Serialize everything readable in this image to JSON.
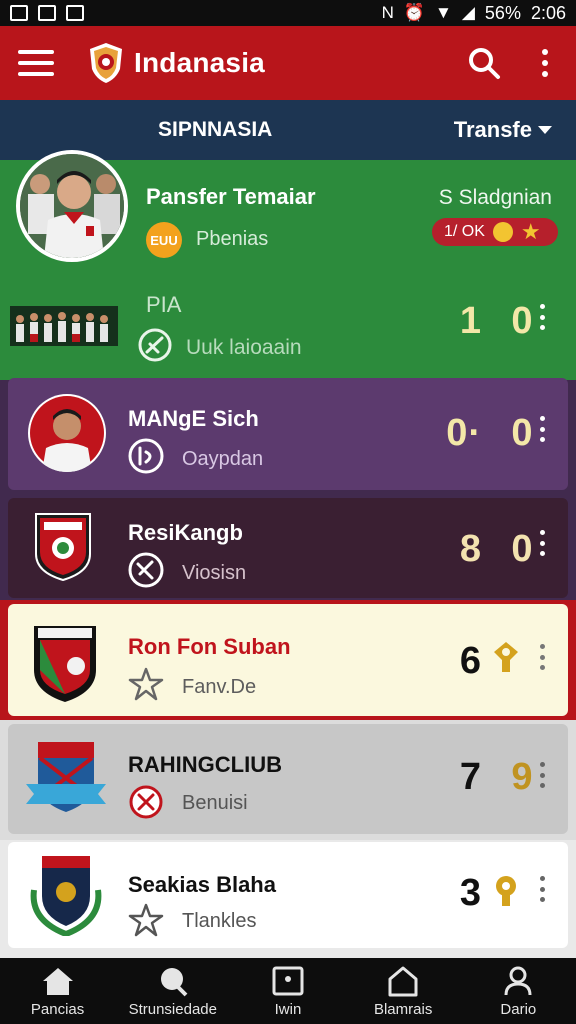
{
  "status_bar": {
    "left_icons": [
      "notification-icon",
      "image-icon",
      "image-icon"
    ],
    "right_icons": [
      "nfc-icon",
      "alarm-icon",
      "wifi-icon",
      "signal-icon"
    ],
    "battery": "56%",
    "time": "2:06"
  },
  "app_bar": {
    "title": "Indanasia",
    "menu_icon": "menu-icon",
    "search_icon": "search-icon",
    "more_icon": "more-vertical-icon"
  },
  "sub_header": {
    "title": "SIPNNASIA",
    "dropdown_label": "Transfe"
  },
  "hero": {
    "name": "Pansfer Temaiar",
    "badge": "EUU",
    "subtitle": "Pbenias",
    "right_text": "S Sladgnian",
    "pill_text": "1/  OK"
  },
  "row2": {
    "title": "PIA",
    "subtitle": "Uuk laioaain",
    "score_home": "1",
    "score_away": "0"
  },
  "cards": [
    {
      "title": "MANgE Sich",
      "subtitle": "Oaypdan",
      "score_home": "0·",
      "score_away": "0",
      "icon": "whistle-icon",
      "colors": {
        "bg": "#5c3a6e",
        "title": "#ffffff",
        "sub": "#d9c8e4",
        "score": "#f3e7a8"
      }
    },
    {
      "title": "ResiKangb",
      "subtitle": "Viosisn",
      "score_home": "8",
      "score_away": "0",
      "icon": "tactics-icon",
      "colors": {
        "bg": "#3a1f32",
        "title": "#ffffff",
        "sub": "#d6c2cc",
        "score": "#f3e2b0"
      }
    },
    {
      "title": "Ron Fon Suban",
      "subtitle": "Fanv.De",
      "score_home": "6",
      "score_away": "",
      "icon": "star-icon",
      "colors": {
        "bg": "#fbf8de",
        "title": "#c0141c",
        "sub": "#5d5d5d",
        "score": "#111111"
      }
    },
    {
      "title": "RAHINGCLIUB",
      "subtitle": "Benuisi",
      "score_home": "7",
      "score_away": "9",
      "icon": "cancel-icon",
      "colors": {
        "bg": "#c7c7c7",
        "title": "#111111",
        "sub": "#555555",
        "score": "#111111"
      }
    },
    {
      "title": "Seakias Blaha",
      "subtitle": "Tlankles",
      "score_home": "3",
      "score_away": "",
      "icon": "star-icon",
      "colors": {
        "bg": "#ffffff",
        "title": "#111111",
        "sub": "#555555",
        "score": "#111111"
      }
    }
  ],
  "bottom_nav": [
    {
      "label": "Pancias",
      "icon": "home-icon"
    },
    {
      "label": "Strunsiedade",
      "icon": "search-icon"
    },
    {
      "label": "Iwin",
      "icon": "tablet-icon"
    },
    {
      "label": "Blamrais",
      "icon": "house-icon"
    },
    {
      "label": "Dario",
      "icon": "user-icon"
    }
  ],
  "colors": {
    "primary": "#b8151b",
    "secondary": "#1d3552",
    "green": "#2c8b3c",
    "gold": "#d4a21d"
  }
}
